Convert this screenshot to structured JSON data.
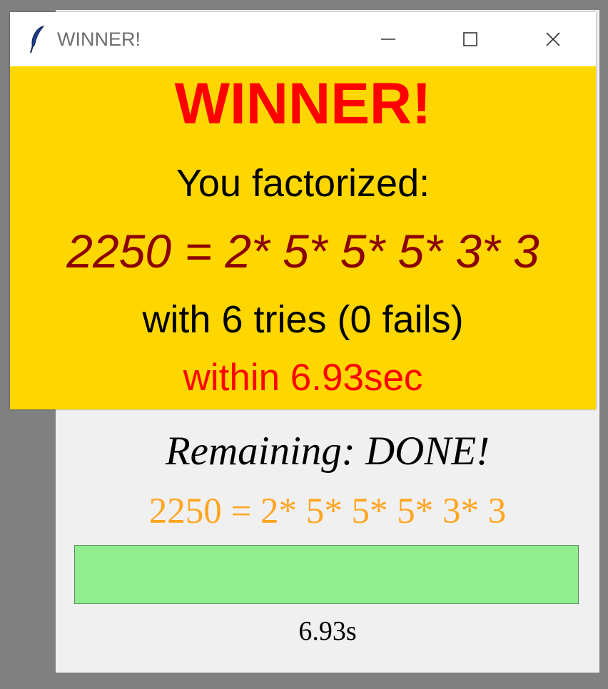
{
  "main_window": {
    "remaining_label": "Remaining: DONE!",
    "equation": "2250 = 2* 5* 5* 5* 3* 3",
    "progress_fraction": 1.0,
    "elapsed_time": "6.93s",
    "colors": {
      "equation": "#ffa520",
      "progress_fill": "#90ee90"
    }
  },
  "dialog": {
    "title": "WINNER!",
    "icon": "feather-icon",
    "heading": "WINNER!",
    "factorized_label": "You factorized:",
    "equation": "2250 = 2* 5* 5* 5* 3* 3",
    "tries_text": "with 6 tries (0 fails)",
    "time_text": "within 6.93sec",
    "colors": {
      "background": "#ffd700",
      "heading": "#ff0000",
      "equation": "#8b0000",
      "time_text": "#ff0000"
    }
  }
}
